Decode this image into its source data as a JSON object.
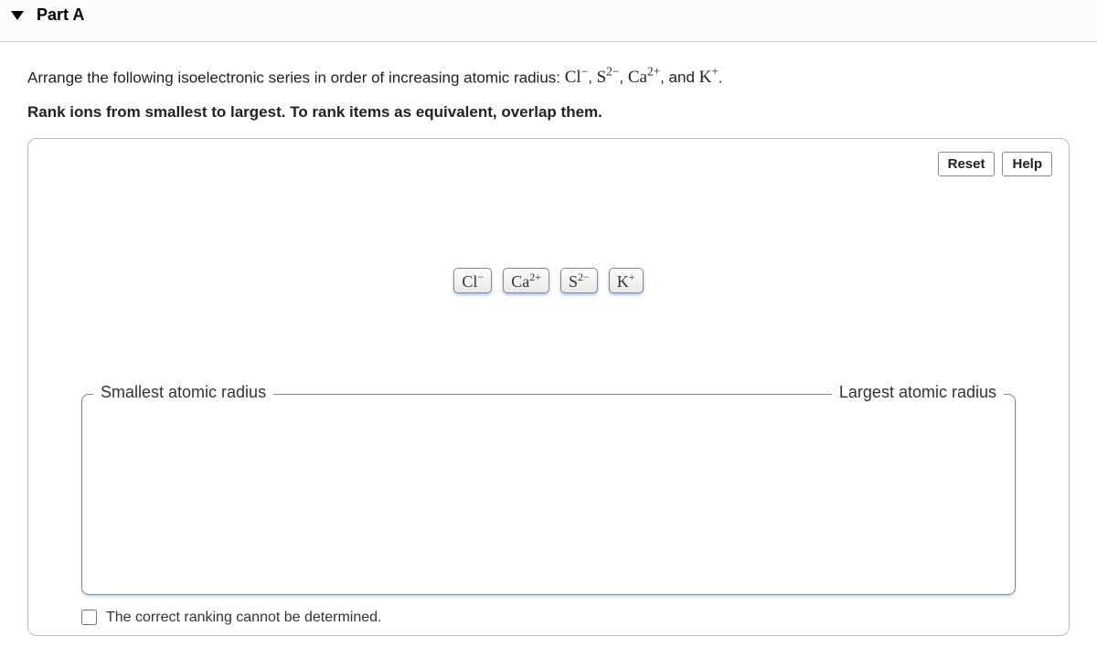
{
  "header": {
    "part_label": "Part A"
  },
  "prompt": {
    "leadin": "Arrange the following isoelectronic series in order of increasing atomic radius: ",
    "ions": [
      {
        "base": "Cl",
        "sup": "−"
      },
      {
        "base": "S",
        "sup": "2−"
      },
      {
        "base": "Ca",
        "sup": "2+"
      },
      {
        "base": "K",
        "sup": "+"
      }
    ],
    "joiner": ", ",
    "last_joiner": ", and ",
    "terminator": "."
  },
  "instruction": "Rank ions from smallest to largest. To rank items as equivalent, overlap them.",
  "buttons": {
    "reset": "Reset",
    "help": "Help"
  },
  "chips": [
    {
      "base": "Cl",
      "sup": "−"
    },
    {
      "base": "Ca",
      "sup": "2+"
    },
    {
      "base": "S",
      "sup": "2−"
    },
    {
      "base": "K",
      "sup": "+"
    }
  ],
  "zone": {
    "left_label": "Smallest atomic radius",
    "right_label": "Largest atomic radius"
  },
  "checkbox": {
    "label": "The correct ranking cannot be determined."
  }
}
